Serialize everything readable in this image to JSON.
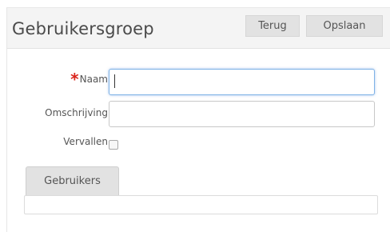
{
  "header": {
    "title": "Gebruikersgroep",
    "back_label": "Terug",
    "save_label": "Opslaan"
  },
  "form": {
    "naam": {
      "required_marker": "*",
      "label": "Naam",
      "value": ""
    },
    "omschrijving": {
      "label": "Omschrijving",
      "value": ""
    },
    "vervallen": {
      "label": "Vervallen",
      "checked": false
    }
  },
  "tabs": [
    {
      "label": "Gebruikers",
      "active": true
    }
  ],
  "colors": {
    "required": "#d9241c",
    "focus_border": "#7fb2e6",
    "header_bg": "#f4f4f4",
    "button_bg": "#e2e2e2"
  }
}
